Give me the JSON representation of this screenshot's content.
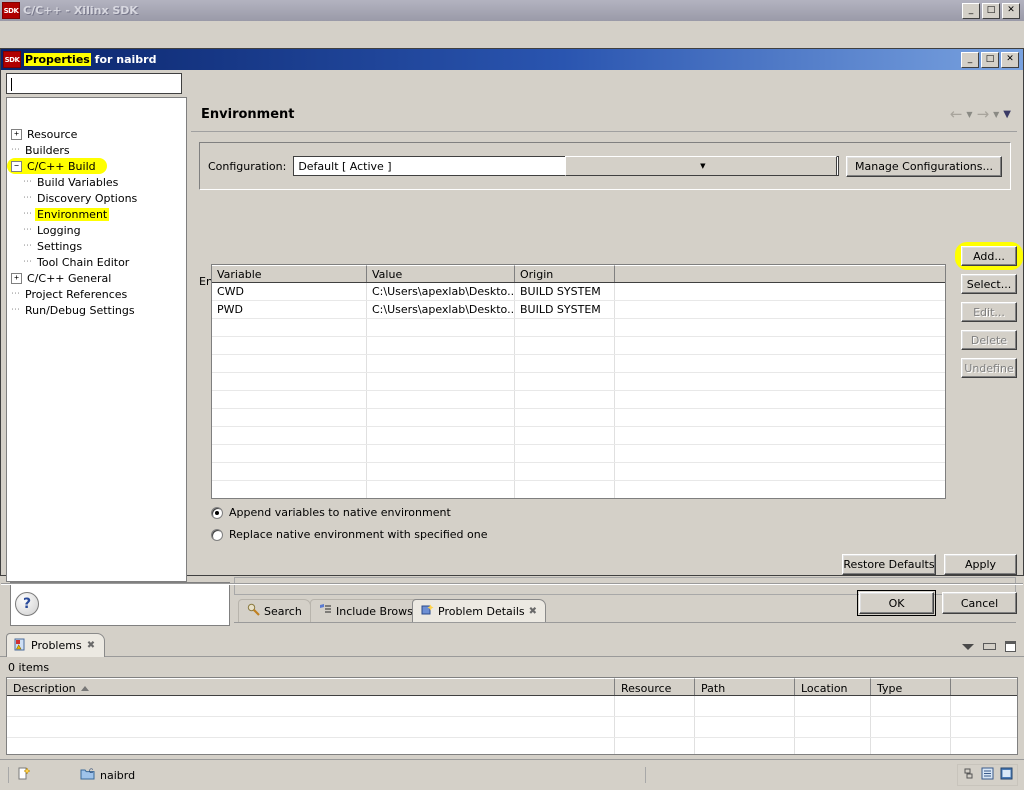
{
  "main_window": {
    "title": "C/C++ - Xilinx SDK",
    "icon": "sdk-icon",
    "window_buttons": [
      "minimize",
      "maximize",
      "close"
    ],
    "button_glyphs": [
      "_",
      "□",
      "✕"
    ]
  },
  "dialog": {
    "title_prefix": "Properties",
    "title_suffix": " for naibrd",
    "icon": "sdk-icon",
    "filter": {
      "value": "",
      "placeholder": ""
    },
    "tree": [
      {
        "label": "Resource",
        "expander": "+",
        "indent": 0,
        "highlighted": false
      },
      {
        "label": "Builders",
        "expander": "",
        "indent": 0,
        "highlighted": false
      },
      {
        "label": "C/C++ Build",
        "expander": "-",
        "indent": 0,
        "highlighted": true
      },
      {
        "label": "Build Variables",
        "expander": "",
        "indent": 1,
        "highlighted": false
      },
      {
        "label": "Discovery Options",
        "expander": "",
        "indent": 1,
        "highlighted": false
      },
      {
        "label": "Environment",
        "expander": "",
        "indent": 1,
        "highlighted": true
      },
      {
        "label": "Logging",
        "expander": "",
        "indent": 1,
        "highlighted": false
      },
      {
        "label": "Settings",
        "expander": "",
        "indent": 1,
        "highlighted": false
      },
      {
        "label": "Tool Chain Editor",
        "expander": "",
        "indent": 1,
        "highlighted": false
      },
      {
        "label": "C/C++ General",
        "expander": "+",
        "indent": 0,
        "highlighted": false
      },
      {
        "label": "Project References",
        "expander": "",
        "indent": 0,
        "highlighted": false
      },
      {
        "label": "Run/Debug Settings",
        "expander": "",
        "indent": 0,
        "highlighted": false
      }
    ],
    "page": {
      "title": "Environment",
      "nav": {
        "back": "←",
        "forward": "→",
        "caret": "▼",
        "menu_caret": "▼"
      },
      "configuration_label": "Configuration:",
      "configuration_value": "Default  [ Active ]",
      "manage_configurations": "Manage Configurations...",
      "section_label": "Environment variables to set",
      "table": {
        "columns": [
          "Variable",
          "Value",
          "Origin",
          ""
        ],
        "rows": [
          {
            "variable": "CWD",
            "value": "C:\\Users\\apexlab\\Deskto...",
            "origin": "BUILD SYSTEM"
          },
          {
            "variable": "PWD",
            "value": "C:\\Users\\apexlab\\Deskto...",
            "origin": "BUILD SYSTEM"
          }
        ],
        "empty_row_count": 11
      },
      "side_buttons": [
        {
          "label": "Add...",
          "enabled": true,
          "highlighted": true
        },
        {
          "label": "Select...",
          "enabled": true,
          "highlighted": false
        },
        {
          "label": "Edit...",
          "enabled": false,
          "highlighted": false
        },
        {
          "label": "Delete",
          "enabled": false,
          "highlighted": false
        },
        {
          "label": "Undefine",
          "enabled": false,
          "highlighted": false
        }
      ],
      "radios": [
        {
          "label": "Append variables to native environment",
          "selected": true
        },
        {
          "label": "Replace native environment with specified one",
          "selected": false
        }
      ],
      "restore_defaults": "Restore Defaults",
      "apply": "Apply"
    },
    "help_glyph": "?",
    "ok": "OK",
    "cancel": "Cancel"
  },
  "views": {
    "top_tabs": [
      {
        "label": "Search",
        "icon": "search-icon",
        "active": false,
        "closable": false
      },
      {
        "label": "Include Browser",
        "icon": "include-browser-icon",
        "active": false,
        "closable": false
      },
      {
        "label": "Problem Details",
        "icon": "problem-details-icon",
        "active": true,
        "closable": true
      }
    ],
    "close_glyph": "✖",
    "problems": {
      "tab_label": "Problems",
      "tab_icon": "problems-icon",
      "count_label": "0 items",
      "columns": [
        "Description",
        "Resource",
        "Path",
        "Location",
        "Type",
        ""
      ],
      "sort_column": "Description",
      "sort_direction": "asc",
      "rows": [],
      "empty_row_count": 4
    }
  },
  "statusbar": {
    "left_icon": "new-item-icon",
    "project_icon": "project-folder-icon",
    "project_name": "naibrd",
    "right_icons": [
      "link-icon",
      "layout-icon",
      "perspective-icon"
    ]
  },
  "colors": {
    "window_bg": "#d4d0c8",
    "title_active_start": "#0a246a",
    "title_inactive": "#9a9aa8",
    "highlight_yellow": "#ffff00",
    "field_bg": "#ffffff",
    "disabled_text": "#808080"
  }
}
